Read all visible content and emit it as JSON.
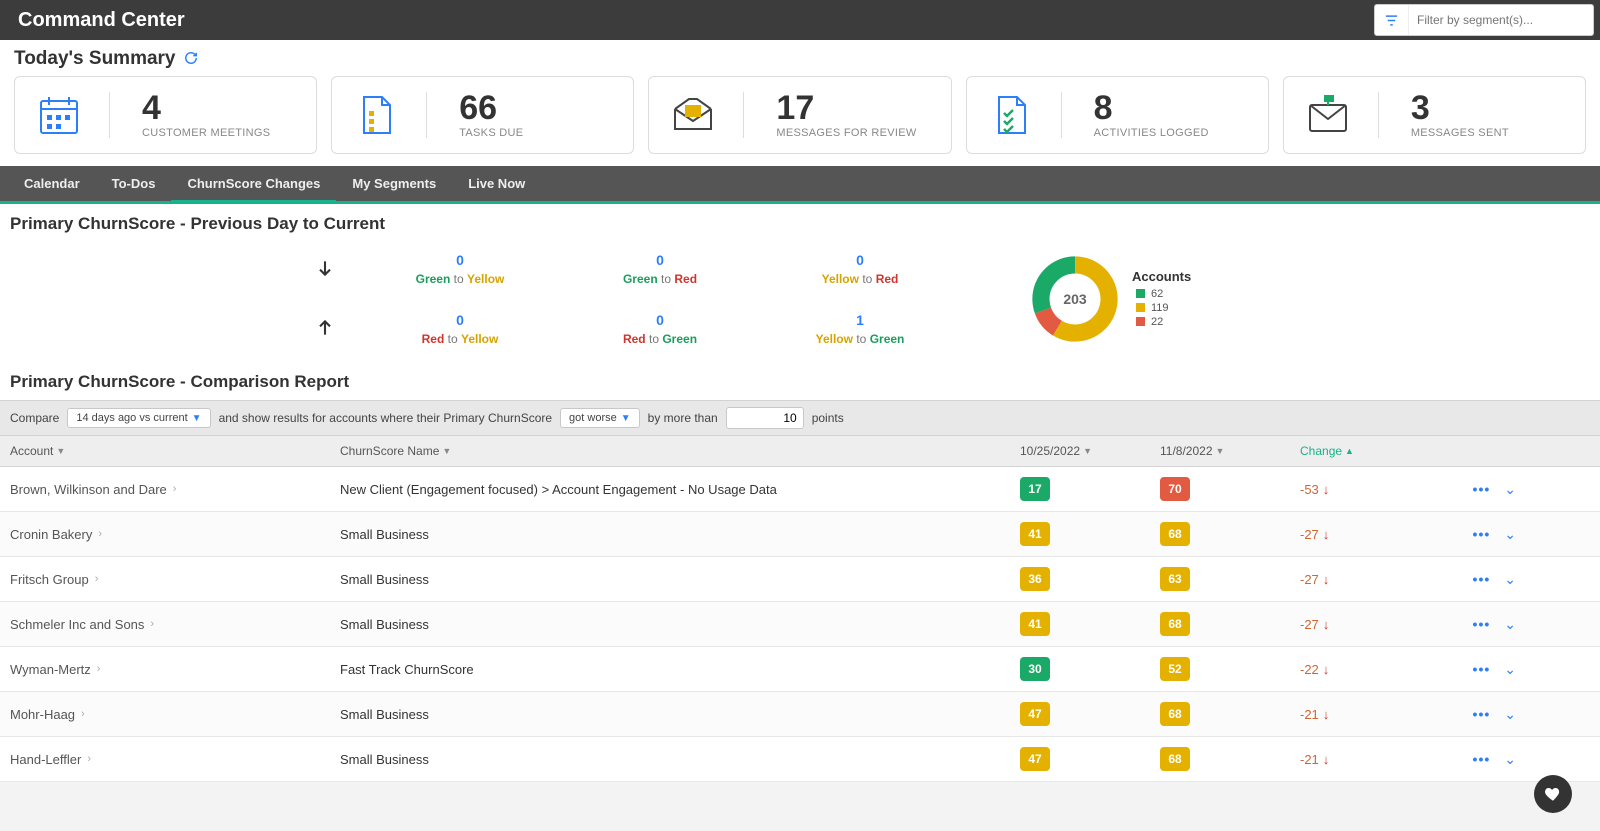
{
  "header": {
    "title": "Command Center",
    "filter_placeholder": "Filter by segment(s)..."
  },
  "summary": {
    "title": "Today's Summary",
    "cards": [
      {
        "value": "4",
        "label": "CUSTOMER MEETINGS"
      },
      {
        "value": "66",
        "label": "TASKS DUE"
      },
      {
        "value": "17",
        "label": "MESSAGES FOR REVIEW"
      },
      {
        "value": "8",
        "label": "ACTIVITIES LOGGED"
      },
      {
        "value": "3",
        "label": "MESSAGES SENT"
      }
    ]
  },
  "tabs": {
    "items": [
      "Calendar",
      "To-Dos",
      "ChurnScore Changes",
      "My Segments",
      "Live Now"
    ],
    "active": 2
  },
  "transitions": {
    "title": "Primary ChurnScore - Previous Day to Current",
    "down": [
      {
        "value": "0",
        "from": "Green",
        "to": "Yellow"
      },
      {
        "value": "0",
        "from": "Green",
        "to": "Red"
      },
      {
        "value": "0",
        "from": "Yellow",
        "to": "Red"
      }
    ],
    "up": [
      {
        "value": "0",
        "from": "Red",
        "to": "Yellow"
      },
      {
        "value": "0",
        "from": "Red",
        "to": "Green"
      },
      {
        "value": "1",
        "from": "Yellow",
        "to": "Green"
      }
    ],
    "accounts_label": "Accounts",
    "total": "203",
    "legend": [
      {
        "color": "#1ba968",
        "value": "62"
      },
      {
        "color": "#e5b100",
        "value": "119"
      },
      {
        "color": "#e15a41",
        "value": "22"
      }
    ]
  },
  "chart_data": {
    "type": "pie",
    "title": "Accounts",
    "categories": [
      "Green",
      "Yellow",
      "Red"
    ],
    "values": [
      62,
      119,
      22
    ],
    "colors": [
      "#1ba968",
      "#e5b100",
      "#e15a41"
    ],
    "total": 203
  },
  "report": {
    "title": "Primary ChurnScore - Comparison Report",
    "bar": {
      "compare_label": "Compare",
      "range": "14 days ago vs current",
      "mid_text": "and show results for accounts where their Primary ChurnScore",
      "direction": "got worse",
      "morethan": "by more than",
      "points_value": "10",
      "points_label": "points"
    },
    "columns": {
      "account": "Account",
      "churn_name": "ChurnScore Name",
      "date_a": "10/25/2022",
      "date_b": "11/8/2022",
      "change": "Change"
    },
    "rows": [
      {
        "account": "Brown, Wilkinson and Dare",
        "name": "New Client (Engagement focused) > Account Engagement - No Usage Data",
        "a": "17",
        "a_color": "bg-green",
        "b": "70",
        "b_color": "bg-red",
        "change": "-53"
      },
      {
        "account": "Cronin Bakery",
        "name": "Small Business",
        "a": "41",
        "a_color": "bg-yellow",
        "b": "68",
        "b_color": "bg-yellow",
        "change": "-27"
      },
      {
        "account": "Fritsch Group",
        "name": "Small Business",
        "a": "36",
        "a_color": "bg-yellow",
        "b": "63",
        "b_color": "bg-yellow",
        "change": "-27"
      },
      {
        "account": "Schmeler Inc and Sons",
        "name": "Small Business",
        "a": "41",
        "a_color": "bg-yellow",
        "b": "68",
        "b_color": "bg-yellow",
        "change": "-27"
      },
      {
        "account": "Wyman-Mertz",
        "name": "Fast Track ChurnScore",
        "a": "30",
        "a_color": "bg-green",
        "b": "52",
        "b_color": "bg-yellow",
        "change": "-22"
      },
      {
        "account": "Mohr-Haag",
        "name": "Small Business",
        "a": "47",
        "a_color": "bg-yellow",
        "b": "68",
        "b_color": "bg-yellow",
        "change": "-21"
      },
      {
        "account": "Hand-Leffler",
        "name": "Small Business",
        "a": "47",
        "a_color": "bg-yellow",
        "b": "68",
        "b_color": "bg-yellow",
        "change": "-21"
      }
    ]
  },
  "word_to": "to"
}
